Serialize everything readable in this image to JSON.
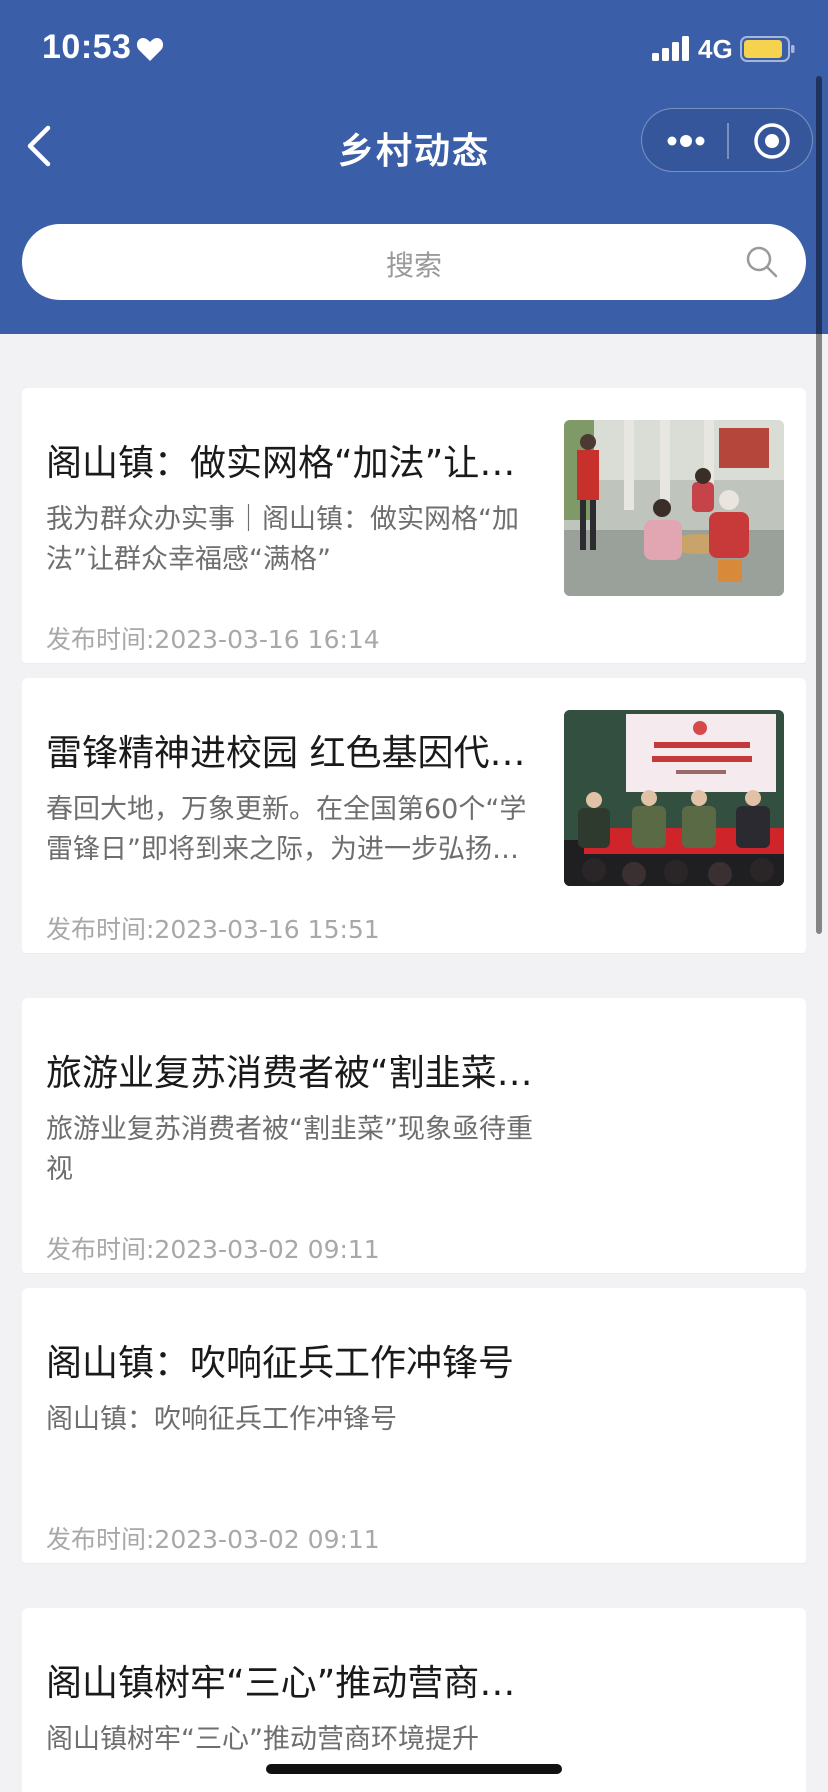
{
  "status_bar": {
    "time": "10:53",
    "network": "4G",
    "battery_color": "#f5d34f"
  },
  "nav": {
    "title": "乡村动态",
    "back_icon": "chevron-left-icon",
    "more_icon": "more-dots-icon",
    "close_icon": "target-circle-icon"
  },
  "search": {
    "placeholder": "搜索",
    "icon": "search-icon"
  },
  "colors": {
    "header_bg": "#3a5ea8",
    "page_bg": "#f2f2f4"
  },
  "news": [
    {
      "title": "阁山镇：做实网格“加法”让群…",
      "summary": "我为群众办实事｜阁山镇：做实网格“加法”让群众幸福感“满格”",
      "time": "发布时间:2023-03-16 16:14",
      "has_image": true
    },
    {
      "title": "雷锋精神进校园 红色基因代代传",
      "summary": "春回大地，万象更新。在全国第60个“学雷锋日”即将到来之际，为进一步弘扬…",
      "time": "发布时间:2023-03-16 15:51",
      "has_image": true
    },
    {
      "title": "旅游业复苏消费者被“割韭菜”…",
      "summary": "旅游业复苏消费者被“割韭菜”现象亟待重视",
      "time": "发布时间:2023-03-02 09:11",
      "has_image": false
    },
    {
      "title": "阁山镇：吹响征兵工作冲锋号",
      "summary": "阁山镇：吹响征兵工作冲锋号",
      "time": "发布时间:2023-03-02 09:11",
      "has_image": false
    },
    {
      "title": "阁山镇树牢“三心”推动营商环…",
      "summary": "阁山镇树牢“三心”推动营商环境提升",
      "time": "",
      "has_image": false
    }
  ]
}
